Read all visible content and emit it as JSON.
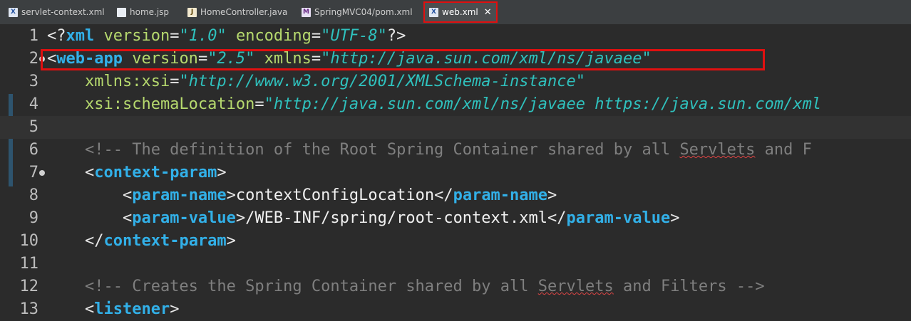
{
  "tabs": [
    {
      "label": "servlet-context.xml",
      "icon": "xml-file-icon",
      "badge": "X"
    },
    {
      "label": "home.jsp",
      "icon": "jsp-file-icon",
      "badge": ""
    },
    {
      "label": "HomeController.java",
      "icon": "java-file-icon",
      "badge": "J"
    },
    {
      "label": "SpringMVC04/pom.xml",
      "icon": "pom-file-icon",
      "badge": "M"
    },
    {
      "label": "web.xml",
      "icon": "xml-file-icon",
      "badge": "X",
      "close": "✕"
    }
  ],
  "lines": [
    {
      "n": "1",
      "seg": [
        [
          "<?",
          "p"
        ],
        [
          "xml",
          "tag"
        ],
        [
          " version",
          "attr"
        ],
        [
          "=",
          "p"
        ],
        [
          "\"1.0\"",
          "str"
        ],
        [
          " encoding",
          "attr"
        ],
        [
          "=",
          "p"
        ],
        [
          "\"UTF-8\"",
          "str"
        ],
        [
          "?>",
          "p"
        ]
      ]
    },
    {
      "n": "2",
      "seg": [
        [
          "<",
          "p"
        ],
        [
          "web-app",
          "tag"
        ],
        [
          " version",
          "attr"
        ],
        [
          "=",
          "p"
        ],
        [
          "\"2.5\"",
          "str"
        ],
        [
          " xmlns",
          "attr"
        ],
        [
          "=",
          "p"
        ],
        [
          "\"http://java.sun.com/xml/ns/javaee\"",
          "str"
        ]
      ]
    },
    {
      "n": "3",
      "seg": [
        [
          "    xmlns:xsi",
          "attr"
        ],
        [
          "=",
          "p"
        ],
        [
          "\"http://www.w3.org/2001/XMLSchema-instance\"",
          "str"
        ]
      ]
    },
    {
      "n": "4",
      "seg": [
        [
          "    xsi:schemaLocation",
          "attr"
        ],
        [
          "=",
          "p"
        ],
        [
          "\"http://java.sun.com/xml/ns/javaee https://java.sun.com/xml",
          "str"
        ]
      ]
    },
    {
      "n": "5",
      "seg": []
    },
    {
      "n": "6",
      "seg": [
        [
          "    <!-- The definition of the Root Spring Container shared by all ",
          "c"
        ],
        [
          "Servlets",
          "cs"
        ],
        [
          " and F",
          "c"
        ]
      ]
    },
    {
      "n": "7",
      "seg": [
        [
          "    <",
          "p"
        ],
        [
          "context-param",
          "tag"
        ],
        [
          ">",
          "p"
        ]
      ]
    },
    {
      "n": "8",
      "seg": [
        [
          "        <",
          "p"
        ],
        [
          "param-name",
          "tag"
        ],
        [
          ">",
          "p"
        ],
        [
          "contextConfigLocation",
          "t"
        ],
        [
          "</",
          "p"
        ],
        [
          "param-name",
          "tag"
        ],
        [
          ">",
          "p"
        ]
      ]
    },
    {
      "n": "9",
      "seg": [
        [
          "        <",
          "p"
        ],
        [
          "param-value",
          "tag"
        ],
        [
          ">",
          "p"
        ],
        [
          "/WEB-INF/spring/root-context.xml",
          "t"
        ],
        [
          "</",
          "p"
        ],
        [
          "param-value",
          "tag"
        ],
        [
          ">",
          "p"
        ]
      ]
    },
    {
      "n": "10",
      "seg": [
        [
          "    </",
          "p"
        ],
        [
          "context-param",
          "tag"
        ],
        [
          ">",
          "p"
        ]
      ]
    },
    {
      "n": "11",
      "seg": []
    },
    {
      "n": "12",
      "seg": [
        [
          "    <!-- Creates the Spring Container shared by all ",
          "c"
        ],
        [
          "Servlets",
          "cs"
        ],
        [
          " and Filters -->",
          "c"
        ]
      ]
    },
    {
      "n": "13",
      "seg": [
        [
          "    <",
          "p"
        ],
        [
          "listener",
          "tag"
        ],
        [
          ">",
          "p"
        ]
      ]
    }
  ]
}
